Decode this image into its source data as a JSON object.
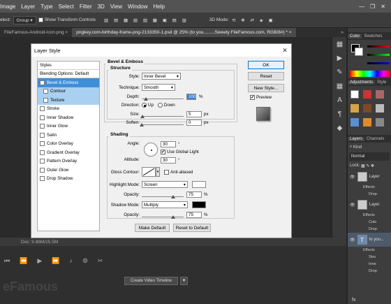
{
  "menubar": {
    "items": [
      "Image",
      "Layer",
      "Type",
      "Select",
      "Filter",
      "3D",
      "View",
      "Window",
      "Help"
    ]
  },
  "options": {
    "select_label": "elect:",
    "select_value": "Group",
    "show_transform": "Show Transform Controls",
    "mode_3d": "3D Mode:"
  },
  "tabs": [
    {
      "label": "FileFamous-Android-Icon.png ×"
    },
    {
      "label": "pngkey.com-birthday-frame-png-2133350-1.psd @ 25% (to you.........Sweety FileFamous.com, RGB/8#) * ×"
    }
  ],
  "tab_more": "»",
  "right_panel": {
    "color_tabs": [
      "Color",
      "Swatches"
    ],
    "adj_tabs": [
      "Adjustments",
      "Style"
    ],
    "layer_tabs": [
      "Layers",
      "Channels"
    ],
    "kind": "Kind",
    "blend": "Normal",
    "lock": "Lock:",
    "layers": [
      {
        "name": "Layer",
        "fx": [
          "Effects",
          "Drop"
        ]
      },
      {
        "name": "Layer",
        "fx": [
          "Effects",
          "Colo",
          "Drop"
        ]
      },
      {
        "name": "to you...",
        "fx": [
          "Effects",
          "Stro",
          "Inne",
          "Drop"
        ]
      }
    ],
    "footer": "fx"
  },
  "status": {
    "doc": "Doc: 9.88M/25.5M"
  },
  "timeline": {
    "create_btn": "Create Video Timeline",
    "watermark": "eFamous"
  },
  "dialog": {
    "title": "Layer Style",
    "styles_header": "Styles",
    "blending": "Blending Options: Default",
    "style_items": [
      {
        "label": "Bevel & Emboss",
        "checked": true,
        "state": "sel"
      },
      {
        "label": "Contour",
        "checked": false,
        "state": "sub"
      },
      {
        "label": "Texture",
        "checked": false,
        "state": "sub"
      },
      {
        "label": "Stroke",
        "checked": false,
        "state": ""
      },
      {
        "label": "Inner Shadow",
        "checked": false,
        "state": ""
      },
      {
        "label": "Inner Glow",
        "checked": false,
        "state": ""
      },
      {
        "label": "Satin",
        "checked": false,
        "state": ""
      },
      {
        "label": "Color Overlay",
        "checked": false,
        "state": ""
      },
      {
        "label": "Gradient Overlay",
        "checked": false,
        "state": ""
      },
      {
        "label": "Pattern Overlay",
        "checked": false,
        "state": ""
      },
      {
        "label": "Outer Glow",
        "checked": false,
        "state": ""
      },
      {
        "label": "Drop Shadow",
        "checked": false,
        "state": ""
      }
    ],
    "bevel": {
      "group": "Bevel & Emboss",
      "structure": "Structure",
      "style_label": "Style:",
      "style_value": "Inner Bevel",
      "technique_label": "Technique:",
      "technique_value": "Smooth",
      "depth_label": "Depth:",
      "depth_value": "100",
      "depth_unit": "%",
      "depth_fraction": 0.1,
      "direction_label": "Direction:",
      "dir_up": "Up",
      "dir_down": "Down",
      "size_label": "Size:",
      "size_value": "5",
      "size_unit": "px",
      "size_fraction": 0.02,
      "soften_label": "Soften:",
      "soften_value": "0",
      "soften_unit": "px",
      "soften_fraction": 0.0
    },
    "shading": {
      "group": "Shading",
      "angle_label": "Angle:",
      "angle_value": "30",
      "angle_unit": "°",
      "global_light": "Use Global Light",
      "altitude_label": "Altitude:",
      "altitude_value": "30",
      "altitude_unit": "°",
      "gloss_label": "Gloss Contour:",
      "anti_alias": "Anti-aliased",
      "hl_mode_label": "Highlight Mode:",
      "hl_mode_value": "Screen",
      "hl_opacity_label": "Opacity:",
      "hl_opacity_value": "75",
      "hl_opacity_unit": "%",
      "hl_opacity_fraction": 0.75,
      "sh_mode_label": "Shadow Mode:",
      "sh_mode_value": "Multiply",
      "sh_opacity_label": "Opacity:",
      "sh_opacity_value": "75",
      "sh_opacity_unit": "%",
      "sh_opacity_fraction": 0.75,
      "hl_color": "#ffffff",
      "sh_color": "#000000"
    },
    "make_default": "Make Default",
    "reset_default": "Reset to Default",
    "ok": "OK",
    "reset": "Reset",
    "new_style": "New Style...",
    "preview": "Preview"
  }
}
